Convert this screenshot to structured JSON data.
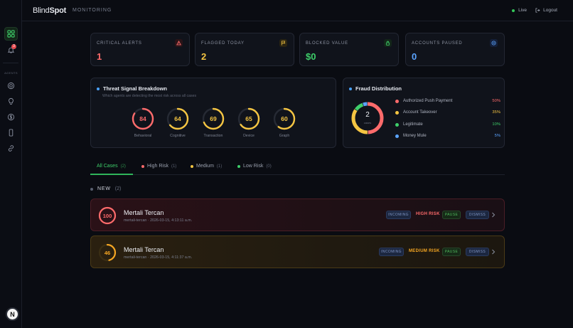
{
  "app": {
    "brand_light": "Blind",
    "brand_bold": "Spot",
    "nav_label": "MONITORING"
  },
  "header": {
    "live_label": "Live",
    "logout_label": "Logout"
  },
  "sidebar": {
    "section_label": "AGENTS",
    "notif_count": "3",
    "user_initial": "N"
  },
  "stats": [
    {
      "label": "CRITICAL ALERTS",
      "value": "1",
      "color": "#ff6b6b",
      "icon": "alert-triangle-icon"
    },
    {
      "label": "FLAGGED TODAY",
      "value": "2",
      "color": "#f5c542",
      "icon": "flag-icon"
    },
    {
      "label": "BLOCKED VALUE",
      "value": "$0",
      "color": "#3ecf6a",
      "icon": "lock-icon"
    },
    {
      "label": "ACCOUNTS PAUSED",
      "value": "0",
      "color": "#5ba4ff",
      "icon": "pause-circle-icon"
    }
  ],
  "threat": {
    "title": "Threat Signal Breakdown",
    "subtitle": "Which agents are detecting the most risk across all cases",
    "gauges": [
      {
        "label": "Behavioral",
        "value": 84,
        "color": "#ff6b6b"
      },
      {
        "label": "Cognitive",
        "value": 64,
        "color": "#f5c542"
      },
      {
        "label": "Transaction",
        "value": 69,
        "color": "#f5c542"
      },
      {
        "label": "Device",
        "value": 65,
        "color": "#f5c542"
      },
      {
        "label": "Graph",
        "value": 60,
        "color": "#f5c542"
      }
    ]
  },
  "fraud": {
    "title": "Fraud Distribution",
    "center_value": "2",
    "center_label": "cases",
    "items": [
      {
        "label": "Authorized Push Payment",
        "pct": "50%",
        "fraction": 0.5,
        "color": "#ff6b6b"
      },
      {
        "label": "Account Takeover",
        "pct": "35%",
        "fraction": 0.35,
        "color": "#f5c542"
      },
      {
        "label": "Legitimate",
        "pct": "10%",
        "fraction": 0.1,
        "color": "#3ecf6a"
      },
      {
        "label": "Money Mule",
        "pct": "5%",
        "fraction": 0.05,
        "color": "#5ba4ff"
      }
    ]
  },
  "tabs": [
    {
      "label": "All Cases",
      "count": "(2)"
    },
    {
      "label": "High Risk",
      "count": "(1)",
      "color": "#ff6b6b"
    },
    {
      "label": "Medium",
      "count": "(1)",
      "color": "#f5c542"
    },
    {
      "label": "Low Risk",
      "count": "(0)",
      "color": "#3ecf6a"
    }
  ],
  "section": {
    "label": "NEW",
    "count": "(2)"
  },
  "cases": [
    {
      "score": "100",
      "fraction": 1.0,
      "color": "#ff6b6b",
      "name": "Mertali Tercan",
      "meta": "mertali-tercan · 2026-03-15, 4:13:11 a.m.",
      "status": "INCOMING",
      "risk": "HIGH RISK",
      "pause": "PAUSE",
      "dismiss": "DISMISS"
    },
    {
      "score": "46",
      "fraction": 0.46,
      "color": "#f5a623",
      "name": "Mertali Tercan",
      "meta": "mertali-tercan · 2026-03-15, 4:11:37 a.m.",
      "status": "INCOMING",
      "risk": "MEDIUM RISK",
      "pause": "PAUSE",
      "dismiss": "DISMISS"
    }
  ]
}
